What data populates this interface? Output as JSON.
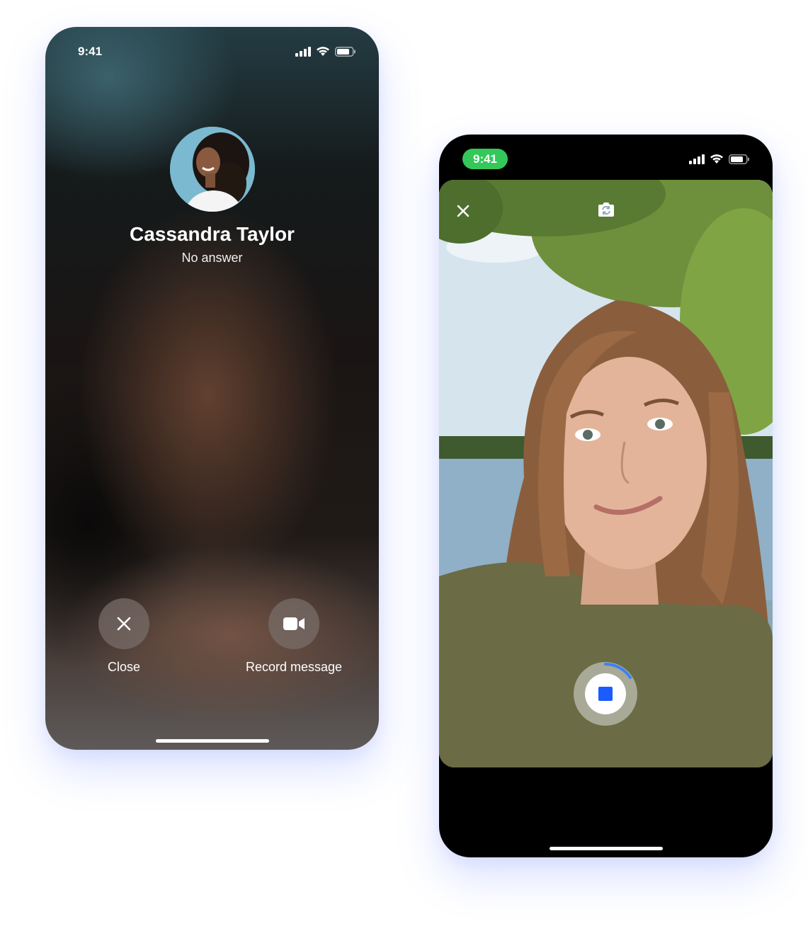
{
  "left_phone": {
    "status_bar": {
      "time": "9:41",
      "icons": [
        "signal-icon",
        "wifi-icon",
        "battery-icon"
      ]
    },
    "caller": {
      "name": "Cassandra Taylor",
      "status": "No answer"
    },
    "actions": {
      "close_label": "Close",
      "close_icon": "close-icon",
      "record_label": "Record message",
      "record_icon": "video-camera-icon"
    }
  },
  "right_phone": {
    "status_bar": {
      "time": "9:41",
      "time_pill_color": "#34c759",
      "icons": [
        "signal-icon",
        "wifi-icon",
        "battery-icon"
      ]
    },
    "camera": {
      "close_icon": "close-icon",
      "switch_icon": "camera-switch-icon",
      "record_button_icon": "stop-icon",
      "stop_color": "#1a5cff"
    }
  }
}
